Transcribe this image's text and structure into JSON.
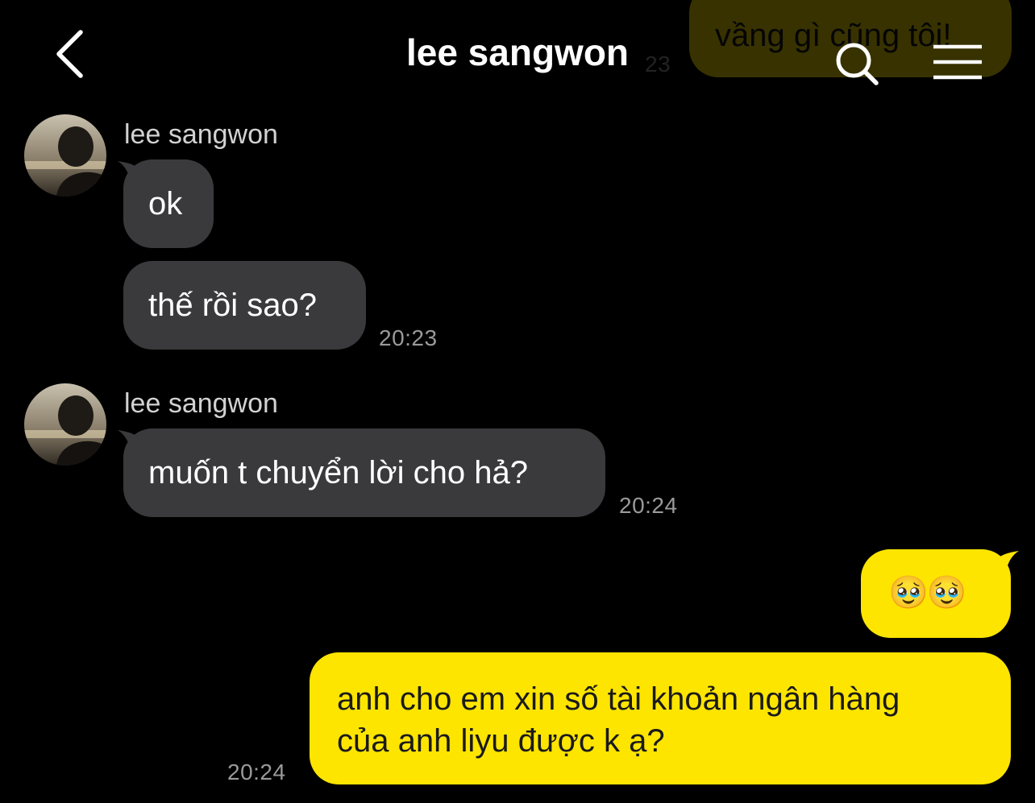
{
  "header": {
    "title": "lee sangwon",
    "back_icon": "chevron-left-icon",
    "search_icon": "search-icon",
    "menu_icon": "hamburger-menu-icon"
  },
  "colors": {
    "background": "#000000",
    "incoming_bubble": "#3a3a3c",
    "outgoing_bubble": "#fee500",
    "timestamp": "#9a9a9a"
  },
  "messages": {
    "behind_header": {
      "text": "vầng gì cũng tôi!",
      "time": "23"
    },
    "group1": {
      "sender": "lee sangwon",
      "msg1": "ok",
      "msg2": "thế rồi sao?",
      "time": "20:23"
    },
    "group2": {
      "sender": "lee sangwon",
      "msg1": "muốn t chuyển lời cho hả?",
      "time": "20:24"
    },
    "outgoing": {
      "msg1": "🥹🥹",
      "msg2_line1": "anh cho em xin số tài khoản ngân hàng",
      "msg2_line2": "của anh liyu được k ạ?",
      "time": "20:24"
    }
  }
}
